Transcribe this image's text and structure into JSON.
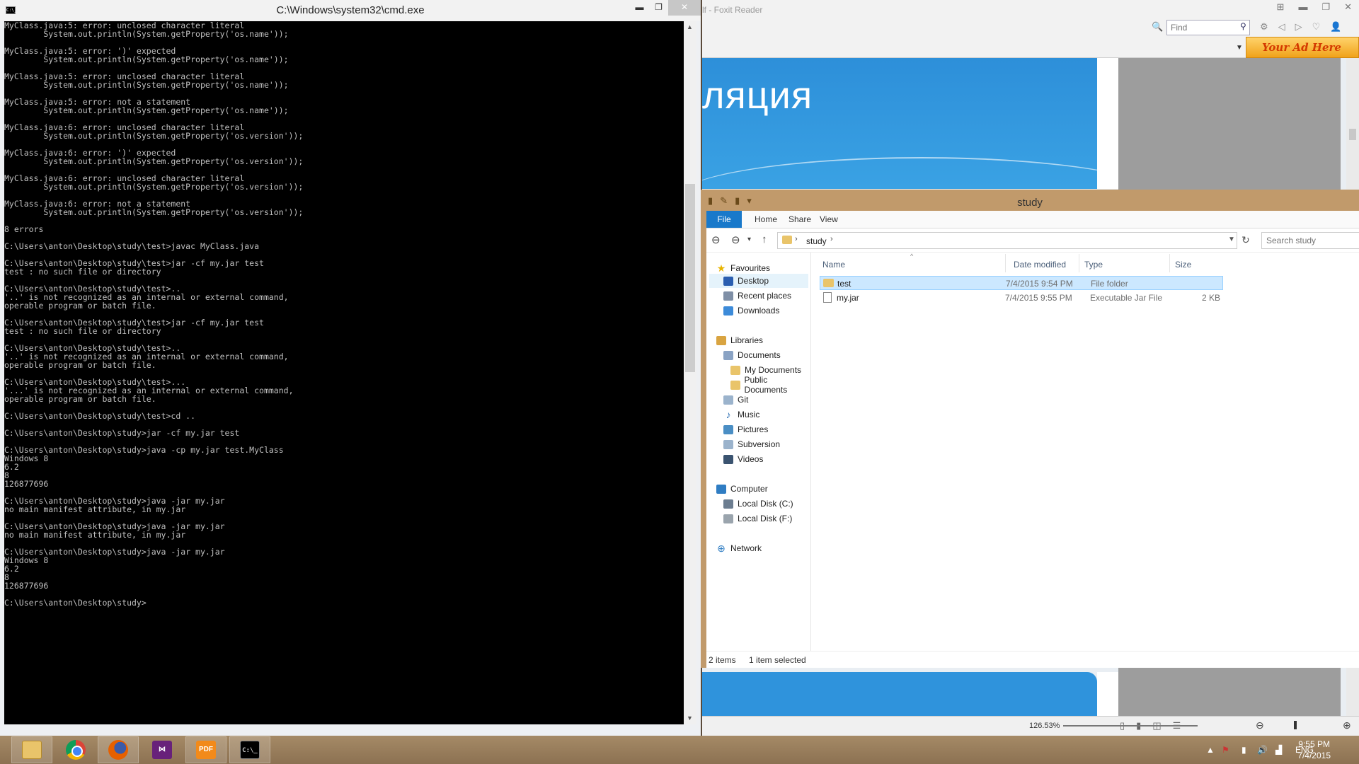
{
  "cmd": {
    "title": "C:\\Windows\\system32\\cmd.exe",
    "icon": "C:\\_",
    "caption": {
      "minimize": "▬",
      "maximize": "❐",
      "close": "✕"
    },
    "lines": [
      "MyClass.java:5: error: unclosed character literal",
      "        System.out.println(System.getProperty('os.name'));",
      "",
      "MyClass.java:5: error: ')' expected",
      "        System.out.println(System.getProperty('os.name'));",
      "",
      "MyClass.java:5: error: unclosed character literal",
      "        System.out.println(System.getProperty('os.name'));",
      "",
      "MyClass.java:5: error: not a statement",
      "        System.out.println(System.getProperty('os.name'));",
      "",
      "MyClass.java:6: error: unclosed character literal",
      "        System.out.println(System.getProperty('os.version'));",
      "",
      "MyClass.java:6: error: ')' expected",
      "        System.out.println(System.getProperty('os.version'));",
      "",
      "MyClass.java:6: error: unclosed character literal",
      "        System.out.println(System.getProperty('os.version'));",
      "",
      "MyClass.java:6: error: not a statement",
      "        System.out.println(System.getProperty('os.version'));",
      "",
      "8 errors",
      "",
      "C:\\Users\\anton\\Desktop\\study\\test>javac MyClass.java",
      "",
      "C:\\Users\\anton\\Desktop\\study\\test>jar -cf my.jar test",
      "test : no such file or directory",
      "",
      "C:\\Users\\anton\\Desktop\\study\\test>..",
      "'..' is not recognized as an internal or external command,",
      "operable program or batch file.",
      "",
      "C:\\Users\\anton\\Desktop\\study\\test>jar -cf my.jar test",
      "test : no such file or directory",
      "",
      "C:\\Users\\anton\\Desktop\\study\\test>..",
      "'..' is not recognized as an internal or external command,",
      "operable program or batch file.",
      "",
      "C:\\Users\\anton\\Desktop\\study\\test>...",
      "'...' is not recognized as an internal or external command,",
      "operable program or batch file.",
      "",
      "C:\\Users\\anton\\Desktop\\study\\test>cd ..",
      "",
      "C:\\Users\\anton\\Desktop\\study>jar -cf my.jar test",
      "",
      "C:\\Users\\anton\\Desktop\\study>java -cp my.jar test.MyClass",
      "Windows 8",
      "6.2",
      "8",
      "126877696",
      "",
      "C:\\Users\\anton\\Desktop\\study>java -jar my.jar",
      "no main manifest attribute, in my.jar",
      "",
      "C:\\Users\\anton\\Desktop\\study>java -jar my.jar",
      "no main manifest attribute, in my.jar",
      "",
      "C:\\Users\\anton\\Desktop\\study>java -jar my.jar",
      "Windows 8",
      "6.2",
      "8",
      "126877696",
      "",
      "C:\\Users\\anton\\Desktop\\study>"
    ],
    "scroll_up": "▲",
    "scroll_down": "▼"
  },
  "foxit": {
    "title": "lf - Foxit Reader",
    "find_placeholder": "Find",
    "ad_text": "Your Ad Here",
    "page_heading": "ляция",
    "zoom": "126.53%",
    "zoom_minus": "⊖",
    "zoom_plus": "⊕"
  },
  "explorer": {
    "title": "study",
    "tabs": {
      "file": "File",
      "home": "Home",
      "share": "Share",
      "view": "View"
    },
    "address": {
      "folder": "study",
      "sep": "›"
    },
    "search_placeholder": "Search study",
    "nav": {
      "favourites": "Favourites",
      "desktop": "Desktop",
      "recent": "Recent places",
      "downloads": "Downloads",
      "libraries": "Libraries",
      "documents": "Documents",
      "my_documents": "My Documents",
      "public_documents": "Public Documents",
      "git": "Git",
      "music": "Music",
      "pictures": "Pictures",
      "subversion": "Subversion",
      "videos": "Videos",
      "computer": "Computer",
      "local_c": "Local Disk (C:)",
      "local_f": "Local Disk (F:)",
      "network": "Network"
    },
    "columns": {
      "name": "Name",
      "date": "Date modified",
      "type": "Type",
      "size": "Size"
    },
    "files": [
      {
        "name": "test",
        "date": "7/4/2015 9:54 PM",
        "type": "File folder",
        "size": ""
      },
      {
        "name": "my.jar",
        "date": "7/4/2015 9:55 PM",
        "type": "Executable Jar File",
        "size": "2 KB"
      }
    ],
    "status": {
      "items": "2 items",
      "selected": "1 item selected"
    }
  },
  "taskbar": {
    "cmd_icon": "C:\\_",
    "foxit_icon": "PDF",
    "language": "ENG",
    "time": "9:55 PM",
    "date": "7/4/2015"
  }
}
